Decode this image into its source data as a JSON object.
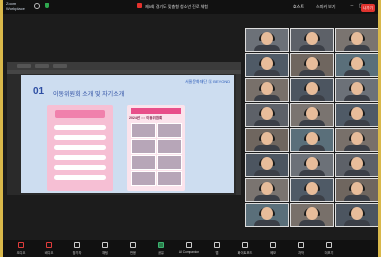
{
  "topbar": {
    "app_name_line1": "Zoom",
    "app_name_line2": "Workplace",
    "meeting_title": "제5회 경기도 맞춤형 청소년 진로 체험",
    "host_label": "호스트",
    "view_label": "스피커 보기",
    "info_label": "정보"
  },
  "slide": {
    "number": "01",
    "title": "이동위원회 소개 및 자기소개",
    "org_logo": "서울문화재단 Ⓢ BEYOND",
    "poster_right_header": "2024년 ○○ 이동위원회"
  },
  "toolbar": {
    "items": [
      {
        "label": "오디오",
        "icon": "mic-icon"
      },
      {
        "label": "비디오",
        "icon": "video-icon"
      },
      {
        "label": "참가자",
        "icon": "participants-icon"
      },
      {
        "label": "채팅",
        "icon": "chat-icon"
      },
      {
        "label": "반응",
        "icon": "heart-icon"
      },
      {
        "label": "공유",
        "icon": "share-icon"
      },
      {
        "label": "AI Companion",
        "icon": "ai-companion-icon"
      },
      {
        "label": "앱",
        "icon": "apps-icon"
      },
      {
        "label": "화이트보드",
        "icon": "whiteboard-icon"
      },
      {
        "label": "메모",
        "icon": "notes-icon"
      },
      {
        "label": "자막",
        "icon": "captions-icon"
      },
      {
        "label": "더보기",
        "icon": "more-icon"
      }
    ],
    "leave_label": "나가기"
  },
  "gallery": {
    "tile_count": 24
  },
  "colors": {
    "background_border": "#d9b84a",
    "meeting_bg": "#1c1c1c",
    "slide_bg": "#cdddf0",
    "leave_red": "#e0342f"
  }
}
